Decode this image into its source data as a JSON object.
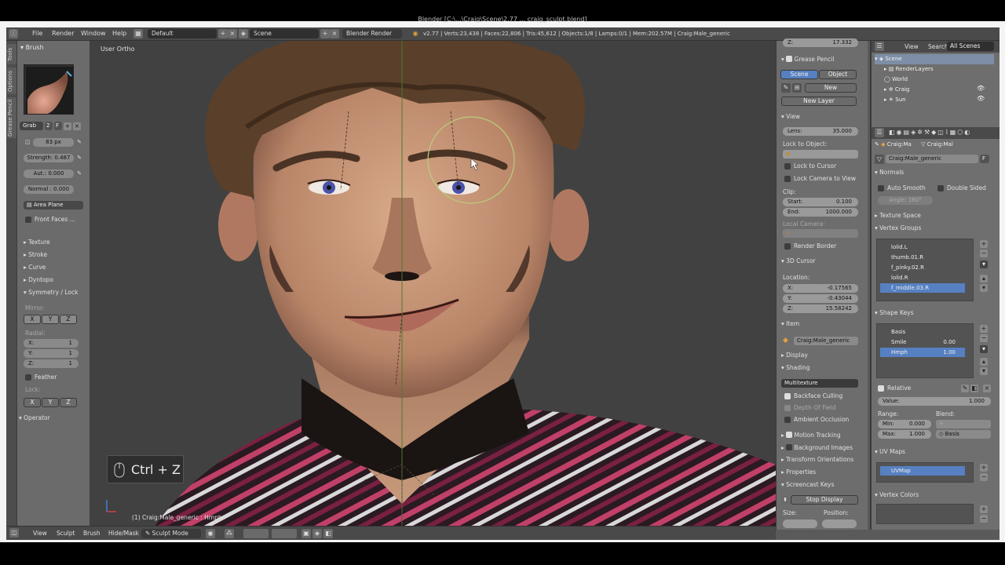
{
  "window": {
    "title": "Blender [C:\\...\\Craig\\Scene\\2.77 ... craig_sculpt.blend]"
  },
  "header": {
    "menus": [
      "File",
      "Render",
      "Window",
      "Help"
    ],
    "layout": "Default",
    "scene": "Scene",
    "engine": "Blender Render",
    "stats": "v2.77 | Verts:23,438 | Faces:22,806 | Tris:45,612 | Objects:1/8 | Lamps:0/1 | Mem:202.57M | Craig:Male_generic"
  },
  "left_tabs": [
    "Tools",
    "Options",
    "Grease Pencil"
  ],
  "brush_panel": {
    "title": "Brush",
    "brush_name": "Grab",
    "users": "2",
    "fake": "F",
    "radius": "83 px",
    "strength": "Strength: 0.487",
    "autosmooth": "Aut.: 0.000",
    "normal": "Normal : 0.000",
    "sculpt_plane": "Area Plane",
    "front_faces": "Front Faces ...",
    "sections": [
      "Texture",
      "Stroke",
      "Curve",
      "Dyntopo",
      "Symmetry / Lock"
    ],
    "mirror_label": "Mirror:",
    "axes": [
      "X",
      "Y",
      "Z"
    ],
    "radial_label": "Radial:",
    "radial": [
      {
        "label": "X:",
        "value": "1"
      },
      {
        "label": "Y:",
        "value": "1"
      },
      {
        "label": "Z:",
        "value": "1"
      }
    ],
    "feather": "Feather",
    "lock_label": "Lock:",
    "operator": "Operator"
  },
  "viewport": {
    "view_label": "User Ortho",
    "object_label": "(1) Craig:Male_generic : Hmph",
    "key_hint": "Ctrl + Z",
    "colors": {
      "background": "#414141",
      "skin": "#c79a7c",
      "hair": "#5a3f2a"
    }
  },
  "npanel": {
    "z_top": {
      "label": "Z:",
      "value": "17.332"
    },
    "grease_pencil": {
      "title": "Grease Pencil",
      "scene": "Scene",
      "object": "Object",
      "new": "New",
      "new_layer": "New Layer"
    },
    "view": {
      "title": "View",
      "lens": {
        "label": "Lens:",
        "value": "35.000"
      },
      "lock_to_object": "Lock to Object:",
      "lock_to_cursor": "Lock to Cursor",
      "lock_camera": "Lock Camera to View",
      "clip": "Clip:",
      "start": {
        "label": "Start:",
        "value": "0.100"
      },
      "end": {
        "label": "End:",
        "value": "1000.000"
      },
      "local_camera": "Local Camera:",
      "render_border": "Render Border"
    },
    "cursor": {
      "title": "3D Cursor",
      "location": "Location:",
      "x": {
        "label": "X:",
        "value": "-0.17565"
      },
      "y": {
        "label": "Y:",
        "value": "-0.43044"
      },
      "z": {
        "label": "Z:",
        "value": "15.58242"
      }
    },
    "item": {
      "title": "Item",
      "name": "Craig:Male_generic"
    },
    "display": "Display",
    "shading": {
      "title": "Shading",
      "mode": "Multitexture",
      "backface": "Backface Culling",
      "dof": "Depth Of Field",
      "ao": "Ambient Occlusion"
    },
    "motion_tracking": "Motion Tracking",
    "background_images": "Background Images",
    "transform_orientations": "Transform Orientations",
    "properties": "Properties",
    "screencast_keys": "Screencast Keys",
    "stop_display": "Stop Display",
    "size_label": "Size:",
    "position_label": "Position:"
  },
  "outliner": {
    "menus": [
      "View",
      "Search",
      "All Scenes"
    ],
    "items": [
      "Scene",
      "RenderLayers",
      "World",
      "Craig",
      "Sun"
    ]
  },
  "properties": {
    "breadcrumb": [
      "Craig:Ma",
      "Craig:Mal"
    ],
    "mesh_name": "Craig:Male_generic",
    "fake": "F",
    "normals": {
      "title": "Normals",
      "auto_smooth": "Auto Smooth",
      "double_sided": "Double Sided",
      "angle": "Angle: 180°"
    },
    "texture_space": "Texture Space",
    "vertex_groups": {
      "title": "Vertex Groups",
      "items": [
        "lolid.L",
        "thumb.01.R",
        "f_pinky.02.R",
        "lolid.R",
        "f_middle.03.R"
      ]
    },
    "shape_keys": {
      "title": "Shape Keys",
      "items": [
        {
          "name": "Basis",
          "value": ""
        },
        {
          "name": "Smile",
          "value": "0.00"
        },
        {
          "name": "Hmph",
          "value": "1.00"
        }
      ],
      "relative": "Relative",
      "value": {
        "label": "Value:",
        "value": "1.000"
      },
      "range": "Range:",
      "blend": "Blend:",
      "min": {
        "label": "Min:",
        "value": "0.000"
      },
      "max": {
        "label": "Max:",
        "value": "1.000"
      },
      "blend_value": "Basis"
    },
    "uv_maps": {
      "title": "UV Maps",
      "items": [
        "UVMap"
      ]
    },
    "vertex_colors": "Vertex Colors"
  },
  "bottom_bar": {
    "menus": [
      "View",
      "Sculpt",
      "Brush",
      "Hide/Mask"
    ],
    "mode": "Sculpt Mode"
  }
}
